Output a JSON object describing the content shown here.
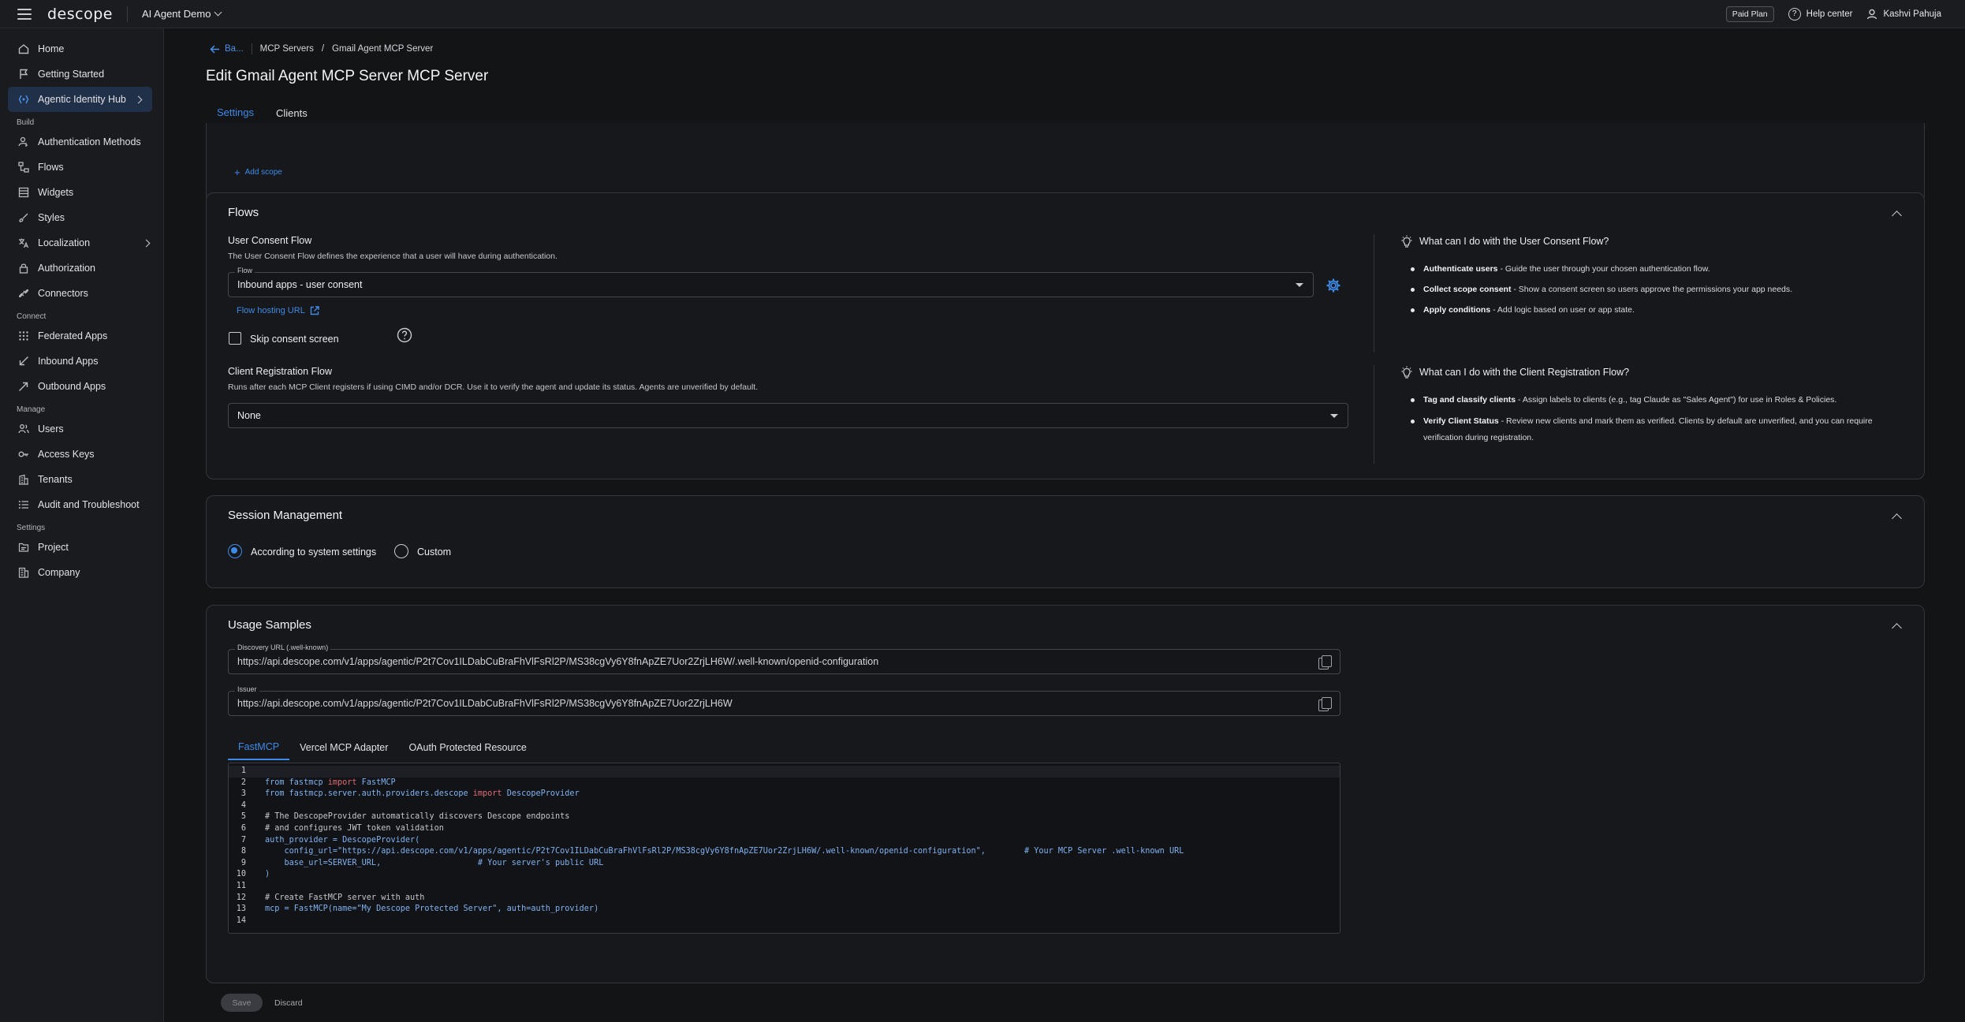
{
  "topbar": {
    "logo": "descope",
    "project": "AI Agent Demo",
    "plan_badge": "Paid Plan",
    "help": "Help center",
    "user": "Kashvi Pahuja"
  },
  "sidebar": {
    "items_top": [
      {
        "label": "Home",
        "icon": "home-icon"
      },
      {
        "label": "Getting Started",
        "icon": "flag-icon"
      },
      {
        "label": "Agentic Identity Hub",
        "icon": "agent-icon"
      }
    ],
    "build_title": "Build",
    "build": [
      {
        "label": "Authentication Methods",
        "icon": "user-key-icon"
      },
      {
        "label": "Flows",
        "icon": "flows-icon"
      },
      {
        "label": "Widgets",
        "icon": "widget-icon"
      },
      {
        "label": "Styles",
        "icon": "brush-icon"
      },
      {
        "label": "Localization",
        "icon": "translate-icon"
      },
      {
        "label": "Authorization",
        "icon": "lock-icon"
      },
      {
        "label": "Connectors",
        "icon": "connector-icon"
      }
    ],
    "connect_title": "Connect",
    "connect": [
      {
        "label": "Federated Apps",
        "icon": "grid-icon"
      },
      {
        "label": "Inbound Apps",
        "icon": "inbound-icon"
      },
      {
        "label": "Outbound Apps",
        "icon": "outbound-icon"
      }
    ],
    "manage_title": "Manage",
    "manage": [
      {
        "label": "Users",
        "icon": "users-icon"
      },
      {
        "label": "Access Keys",
        "icon": "key-icon"
      },
      {
        "label": "Tenants",
        "icon": "building-icon"
      },
      {
        "label": "Audit and Troubleshoot",
        "icon": "list-icon"
      }
    ],
    "settings_title": "Settings",
    "settings": [
      {
        "label": "Project",
        "icon": "folder-icon"
      },
      {
        "label": "Company",
        "icon": "company-icon"
      }
    ]
  },
  "header": {
    "back": "Ba...",
    "crumb1": "MCP Servers",
    "crumb_sep": "/",
    "crumb2": "Gmail Agent MCP Server",
    "title": "Edit Gmail Agent MCP Server MCP Server",
    "tabs": [
      "Settings",
      "Clients"
    ]
  },
  "scopes": {
    "add_scope": "Add scope"
  },
  "flows": {
    "title": "Flows",
    "consent_label": "User Consent Flow",
    "consent_desc": "The User Consent Flow defines the experience that a user will have during authentication.",
    "flow_field_label": "Flow",
    "flow_value": "Inbound apps - user consent",
    "hosting_link": "Flow hosting URL",
    "skip_label": "Skip consent screen",
    "reg_label": "Client Registration Flow",
    "reg_desc": "Runs after each MCP Client registers if using CIMD and/or DCR. Use it to verify the agent and update its status. Agents are unverified by default.",
    "reg_value": "None",
    "info1_title": "What can I do with the User Consent Flow?",
    "info1": [
      {
        "b": "Authenticate users",
        "t": " - Guide the user through your chosen authentication flow."
      },
      {
        "b": "Collect scope consent",
        "t": " - Show a consent screen so users approve the permissions your app needs."
      },
      {
        "b": "Apply conditions",
        "t": " - Add logic based on user or app state."
      }
    ],
    "info2_title": "What can I do with the Client Registration Flow?",
    "info2": [
      {
        "b": "Tag and classify clients",
        "t": " - Assign labels to clients (e.g., tag Claude as \"Sales Agent\") for use in Roles & Policies."
      },
      {
        "b": "Verify Client Status",
        "t": " - Review new clients and mark them as verified. Clients by default are unverified, and you can require verification during registration."
      }
    ]
  },
  "session": {
    "title": "Session Management",
    "option1": "According to system settings",
    "option2": "Custom"
  },
  "usage": {
    "title": "Usage Samples",
    "discovery_label": "Discovery URL (.well-known)",
    "discovery_value": "https://api.descope.com/v1/apps/agentic/P2t7Cov1ILDabCuBraFhVlFsRl2P/MS38cgVy6Y8fnApZE7Uor2ZrjLH6W/.well-known/openid-configuration",
    "issuer_label": "Issuer",
    "issuer_value": "https://api.descope.com/v1/apps/agentic/P2t7Cov1ILDabCuBraFhVlFsRl2P/MS38cgVy6Y8fnApZE7Uor2ZrjLH6W",
    "code_tabs": [
      "FastMCP",
      "Vercel MCP Adapter",
      "OAuth Protected Resource"
    ],
    "code": {
      "l2a": "from fastmcp ",
      "l2k": "import",
      "l2b": " FastMCP",
      "l3a": "from fastmcp.server.auth.providers.descope ",
      "l3k": "import",
      "l3b": " DescopeProvider",
      "l5": "# The DescopeProvider automatically discovers Descope endpoints",
      "l6": "# and configures JWT token validation",
      "l7": "auth_provider = DescopeProvider(",
      "l8": "    config_url=\"https://api.descope.com/v1/apps/agentic/P2t7Cov1ILDabCuBraFhVlFsRl2P/MS38cgVy6Y8fnApZE7Uor2ZrjLH6W/.well-known/openid-configuration\",        # Your MCP Server .well-known URL",
      "l9": "    base_url=SERVER_URL,                    # Your server's public URL",
      "l10": ")",
      "l12": "# Create FastMCP server with auth",
      "l13": "mcp = FastMCP(name=\"My Descope Protected Server\", auth=auth_provider)"
    }
  },
  "footer": {
    "save": "Save",
    "discard": "Discard"
  },
  "colors": {
    "accent": "#3e8ae8",
    "bg": "#131416",
    "card": "#17181b"
  }
}
